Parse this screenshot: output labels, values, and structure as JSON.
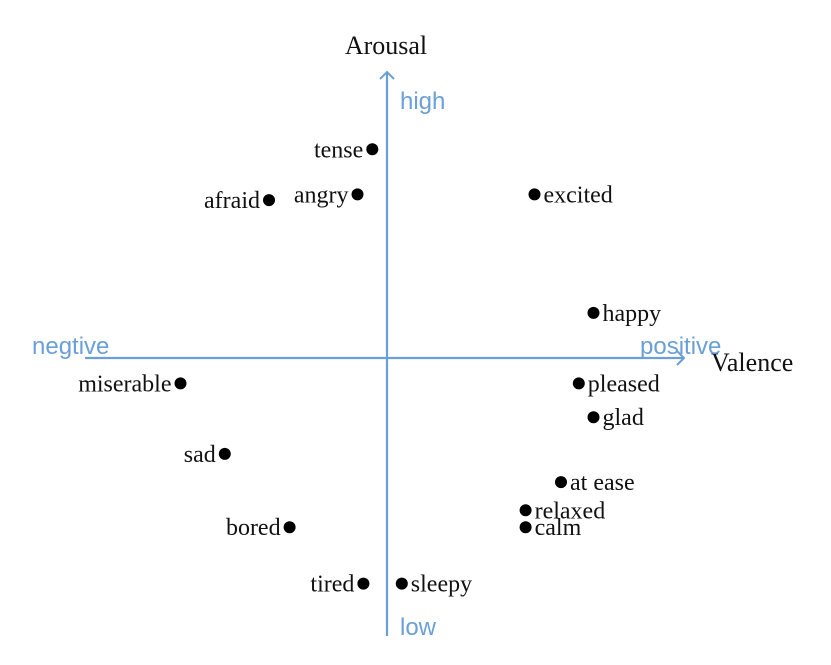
{
  "axes": {
    "y_title": "Arousal",
    "x_title": "Valence",
    "y_high": "high",
    "y_low": "low",
    "x_negative": "negtive",
    "x_positive": "positive",
    "axis_color": "#6a9fd8"
  },
  "emotions": [
    {
      "label": "tense",
      "valence": -0.05,
      "arousal": 0.74
    },
    {
      "label": "angry",
      "valence": -0.1,
      "arousal": 0.58
    },
    {
      "label": "afraid",
      "valence": -0.4,
      "arousal": 0.56
    },
    {
      "label": "excited",
      "valence": 0.5,
      "arousal": 0.58
    },
    {
      "label": "happy",
      "valence": 0.7,
      "arousal": 0.16
    },
    {
      "label": "pleased",
      "valence": 0.65,
      "arousal": -0.09
    },
    {
      "label": "glad",
      "valence": 0.7,
      "arousal": -0.21
    },
    {
      "label": "miserable",
      "valence": -0.7,
      "arousal": -0.09
    },
    {
      "label": "sad",
      "valence": -0.55,
      "arousal": -0.34
    },
    {
      "label": "at ease",
      "valence": 0.59,
      "arousal": -0.44
    },
    {
      "label": "relaxed",
      "valence": 0.47,
      "arousal": -0.54
    },
    {
      "label": "calm",
      "valence": 0.47,
      "arousal": -0.6
    },
    {
      "label": "bored",
      "valence": -0.33,
      "arousal": -0.6
    },
    {
      "label": "tired",
      "valence": -0.08,
      "arousal": -0.8
    },
    {
      "label": "sleepy",
      "valence": 0.05,
      "arousal": -0.8
    }
  ]
}
